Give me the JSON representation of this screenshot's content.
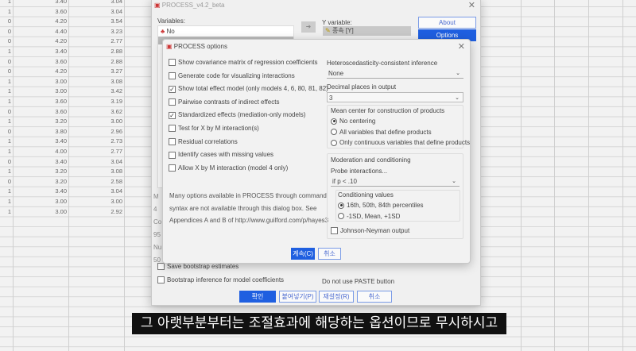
{
  "spreadsheet": {
    "rows": [
      [
        "1",
        "3.40",
        "3.04"
      ],
      [
        "1",
        "3.60",
        "3.04"
      ],
      [
        "0",
        "4.20",
        "3.54"
      ],
      [
        "0",
        "4.40",
        "3.23"
      ],
      [
        "0",
        "4.20",
        "2.77"
      ],
      [
        "1",
        "3.40",
        "2.88"
      ],
      [
        "0",
        "3.60",
        "2.88"
      ],
      [
        "0",
        "4.20",
        "3.27"
      ],
      [
        "1",
        "3.00",
        "3.08"
      ],
      [
        "1",
        "3.00",
        "3.42"
      ],
      [
        "1",
        "3.60",
        "3.19"
      ],
      [
        "0",
        "3.60",
        "3.62"
      ],
      [
        "1",
        "3.20",
        "3.00"
      ],
      [
        "0",
        "3.80",
        "2.96"
      ],
      [
        "1",
        "3.40",
        "2.73"
      ],
      [
        "1",
        "4.00",
        "2.77"
      ],
      [
        "0",
        "3.40",
        "3.04"
      ],
      [
        "1",
        "3.20",
        "3.08"
      ],
      [
        "0",
        "3.20",
        "2.58"
      ],
      [
        "1",
        "3.40",
        "3.04"
      ],
      [
        "1",
        "3.00",
        "3.00"
      ],
      [
        "1",
        "3.00",
        "2.92"
      ]
    ]
  },
  "main": {
    "title": "PROCESS_v4.2_beta",
    "variables_label": "Variables:",
    "variables": [
      "No"
    ],
    "arrow": "➜",
    "y_label": "Y variable:",
    "y_value": "종속 [Y]",
    "about": "About",
    "options": "Options",
    "partial_labels": [
      "M",
      "4",
      "Co",
      "95",
      "Nu",
      "50"
    ],
    "save_boot": "Save bootstrap estimates",
    "boot_inference": "Bootstrap inference for model coefficients",
    "no_paste": "Do not use PASTE button",
    "ok": "확인",
    "paste": "붙여넣기(P)",
    "reset": "재설정(R)",
    "cancel": "취소"
  },
  "options": {
    "title": "PROCESS options",
    "checkboxes": [
      {
        "label": "Show covariance matrix of regression coefficients",
        "checked": false
      },
      {
        "label": "Generate code for visualizing interactions",
        "checked": false
      },
      {
        "label": "Show total effect model (only models 4, 6, 80, 81, 82)",
        "checked": true
      },
      {
        "label": "Pairwise contrasts of indirect effects",
        "checked": false
      },
      {
        "label": "Standardized effects (mediation-only models)",
        "checked": true
      },
      {
        "label": "Test for X by M interaction(s)",
        "checked": false
      },
      {
        "label": "Residual correlations",
        "checked": false
      },
      {
        "label": "Identify cases with missing values",
        "checked": false
      },
      {
        "label": "Allow X by M interaction (model 4 only)",
        "checked": false
      }
    ],
    "note": [
      "Many options available in PROCESS through command",
      "syntax are not available through this dialog box.  See",
      "Appendices A and B of http://www.guilford.com/p/hayes3"
    ],
    "hc_label": "Heteroscedasticity-consistent inference",
    "hc_value": "None",
    "dec_label": "Decimal places in output",
    "dec_value": "3",
    "center_label": "Mean center for construction of products",
    "center_options": [
      {
        "label": "No centering",
        "on": true
      },
      {
        "label": "All variables that define products",
        "on": false
      },
      {
        "label": "Only continuous variables that define products",
        "on": false
      }
    ],
    "mod_label": "Moderation and conditioning",
    "probe_label": "Probe interactions...",
    "probe_value": "if p < .10",
    "cond_label": "Conditioning values",
    "cond_options": [
      {
        "label": "16th, 50th, 84th percentiles",
        "on": true
      },
      {
        "label": "-1SD, Mean, +1SD",
        "on": false
      }
    ],
    "jn_label": "Johnson-Neyman output",
    "continue": "계속(C)",
    "cancel": "취소"
  },
  "subtitle": "그 아랫부분부터는 조절효과에 해당하는 옵션이므로 무시하시고"
}
